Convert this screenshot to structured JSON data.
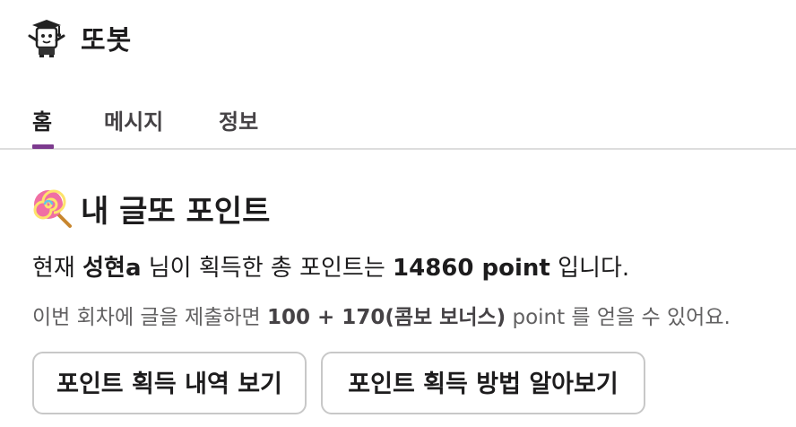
{
  "app": {
    "bot_name": "또봇"
  },
  "tabs": [
    {
      "label": "홈",
      "active": true
    },
    {
      "label": "메시지",
      "active": false
    },
    {
      "label": "정보",
      "active": false
    }
  ],
  "section": {
    "icon": "lollipop-icon",
    "title": "내 글또 포인트"
  },
  "points_line": {
    "prefix": "현재 ",
    "user_name": "성현a",
    "middle": " 님이 획득한 총 포인트는 ",
    "total": "14860 point",
    "suffix": " 입니다."
  },
  "submission_line": {
    "prefix": "이번 회차에 글을 제출하면 ",
    "bonus": "100 + 170(콤보 보너스)",
    "suffix": " point 를 얻을 수 있어요."
  },
  "buttons": {
    "history": "포인트 획득 내역 보기",
    "how_to": "포인트 획득 방법 알아보기"
  },
  "colors": {
    "active_tab_accent": "#7c3a8e",
    "divider": "#dddddd",
    "button_border": "#c8c8c8"
  }
}
